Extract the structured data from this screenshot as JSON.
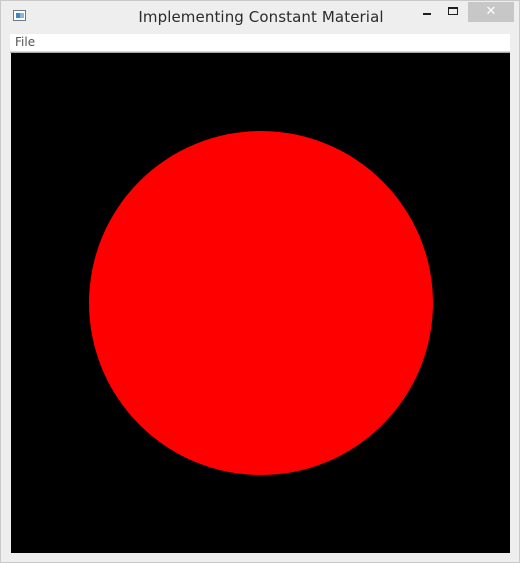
{
  "window": {
    "title": "Implementing Constant Material",
    "icon": "java-app-icon",
    "controls": {
      "minimize": "minimize-icon",
      "maximize": "maximize-icon",
      "close_label": "✕"
    }
  },
  "menubar": {
    "items": [
      {
        "label": "File"
      }
    ]
  },
  "scene": {
    "background_color": "#000000",
    "shape": "sphere",
    "material": "constant",
    "color": "#ff0000"
  }
}
